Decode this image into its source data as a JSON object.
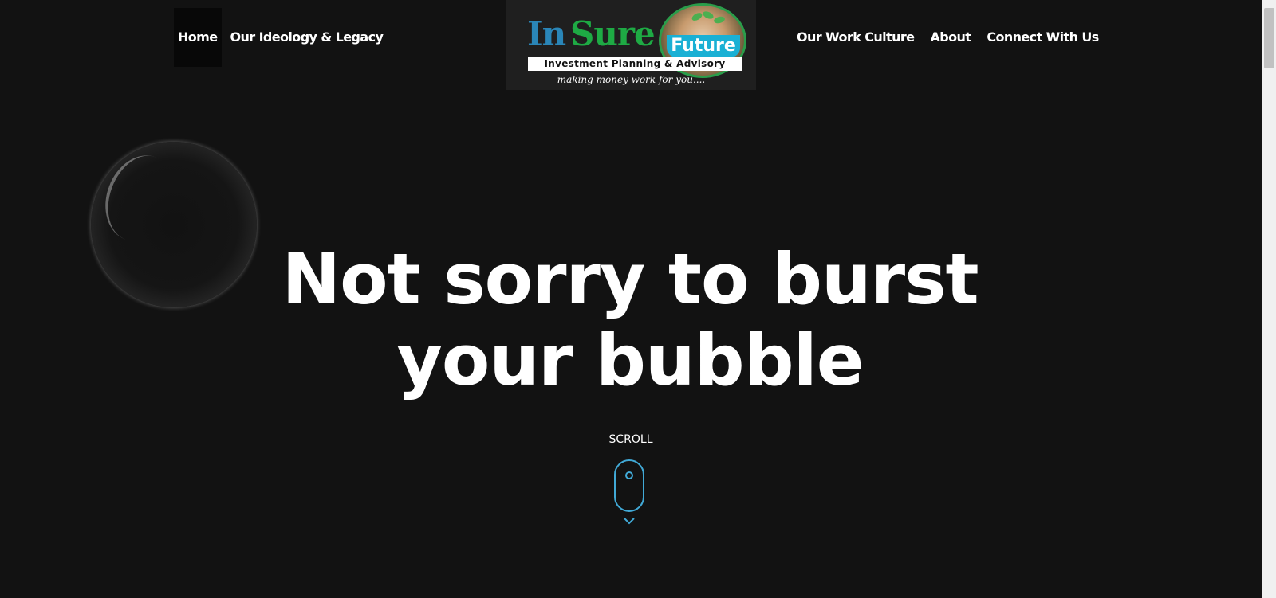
{
  "nav": {
    "left": [
      {
        "label": "Home",
        "active": true
      },
      {
        "label": "Our Ideology & Legacy",
        "active": false
      }
    ],
    "right": [
      {
        "label": "Our Work Culture"
      },
      {
        "label": "About"
      },
      {
        "label": "Connect With Us"
      }
    ]
  },
  "logo": {
    "in": "In",
    "sure": "Sure",
    "future": "Future",
    "band": "Investment Planning & Advisory",
    "tagline": "making money work for you....",
    "colors": {
      "in": "#2a86b8",
      "sure": "#1eaa44",
      "future_bg": "#1ab0d4"
    }
  },
  "hero": {
    "line1": "Not sorry to burst",
    "line2": "your bubble"
  },
  "scroll": {
    "label": "SCROLL",
    "icon": "mouse-scroll-icon",
    "accent": "#41a9d6"
  },
  "colors": {
    "background": "#121212",
    "text": "#ffffff"
  }
}
